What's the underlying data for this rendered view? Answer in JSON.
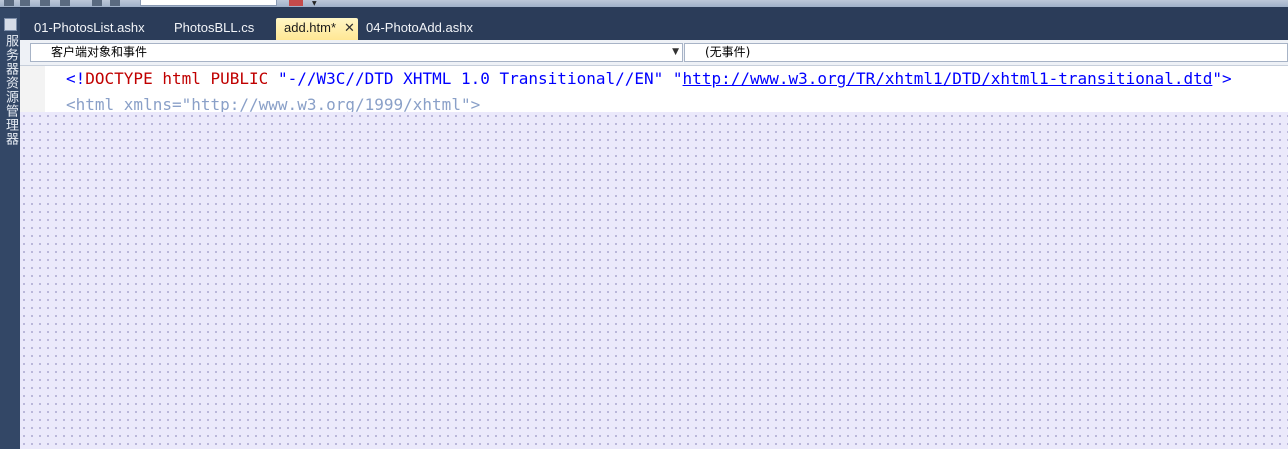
{
  "toolbar": {
    "search_value": ""
  },
  "side_panel": {
    "label": "服务器资源管理器"
  },
  "tabs": [
    {
      "label": "01-PhotosList.ashx",
      "active": false
    },
    {
      "label": "PhotosBLL.cs",
      "active": false
    },
    {
      "label": "add.htm*",
      "active": true
    },
    {
      "label": "04-PhotoAdd.ashx",
      "active": false
    }
  ],
  "close_glyph": "✕",
  "nav": {
    "object_dropdown": "客户端对象和事件",
    "event_dropdown": "(无事件)"
  },
  "code": {
    "line1": {
      "open": "<!",
      "doctype": "DOCTYPE",
      "html": "html",
      "public": "PUBLIC",
      "fpi": "\"-//W3C//DTD XHTML 1.0 Transitional//EN\"",
      "q1": "\"",
      "url": "http://www.w3.org/TR/xhtml1/DTD/xhtml1-transitional.dtd",
      "q2": "\">"
    },
    "line2": "<html xmlns=\"http://www.w3.org/1999/xhtml\">"
  }
}
